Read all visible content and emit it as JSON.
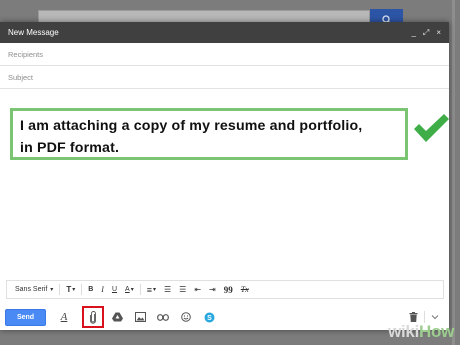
{
  "window": {
    "title": "New Message",
    "minimize": "_",
    "popout": "⤢",
    "close": "×"
  },
  "fields": {
    "recipients_placeholder": "Recipients",
    "subject_placeholder": "Subject"
  },
  "message": {
    "line1": "I am attaching a copy of my resume and portfolio,",
    "line2": "in PDF format."
  },
  "format_toolbar": {
    "font": "Sans Serif",
    "font_arrow": "▾",
    "size": "T",
    "size_arrow": "▾",
    "bold": "B",
    "italic": "I",
    "underline": "U",
    "color": "A",
    "color_arrow": "▾",
    "align": "≡",
    "align_arrow": "▾",
    "numbered": "☰",
    "bulleted": "☰",
    "indent_less": "⇤",
    "indent_more": "⇥",
    "quote": "99",
    "clear": "Tx"
  },
  "bottom_toolbar": {
    "send_label": "Send",
    "formatting": "A"
  },
  "watermark": {
    "wiki": "wiki",
    "how": "How"
  },
  "colors": {
    "send": "#4a8af4",
    "highlight_box": "#d8111c",
    "callout_border": "#7bc471",
    "checkmark": "#3fae49",
    "titlebar": "#404040"
  },
  "icons": [
    "search-icon",
    "minimize-icon",
    "popout-icon",
    "close-icon",
    "checkmark-icon",
    "attach-icon",
    "drive-icon",
    "photo-icon",
    "link-icon",
    "emoji-icon",
    "skype-icon",
    "trash-icon",
    "more-options-icon"
  ]
}
